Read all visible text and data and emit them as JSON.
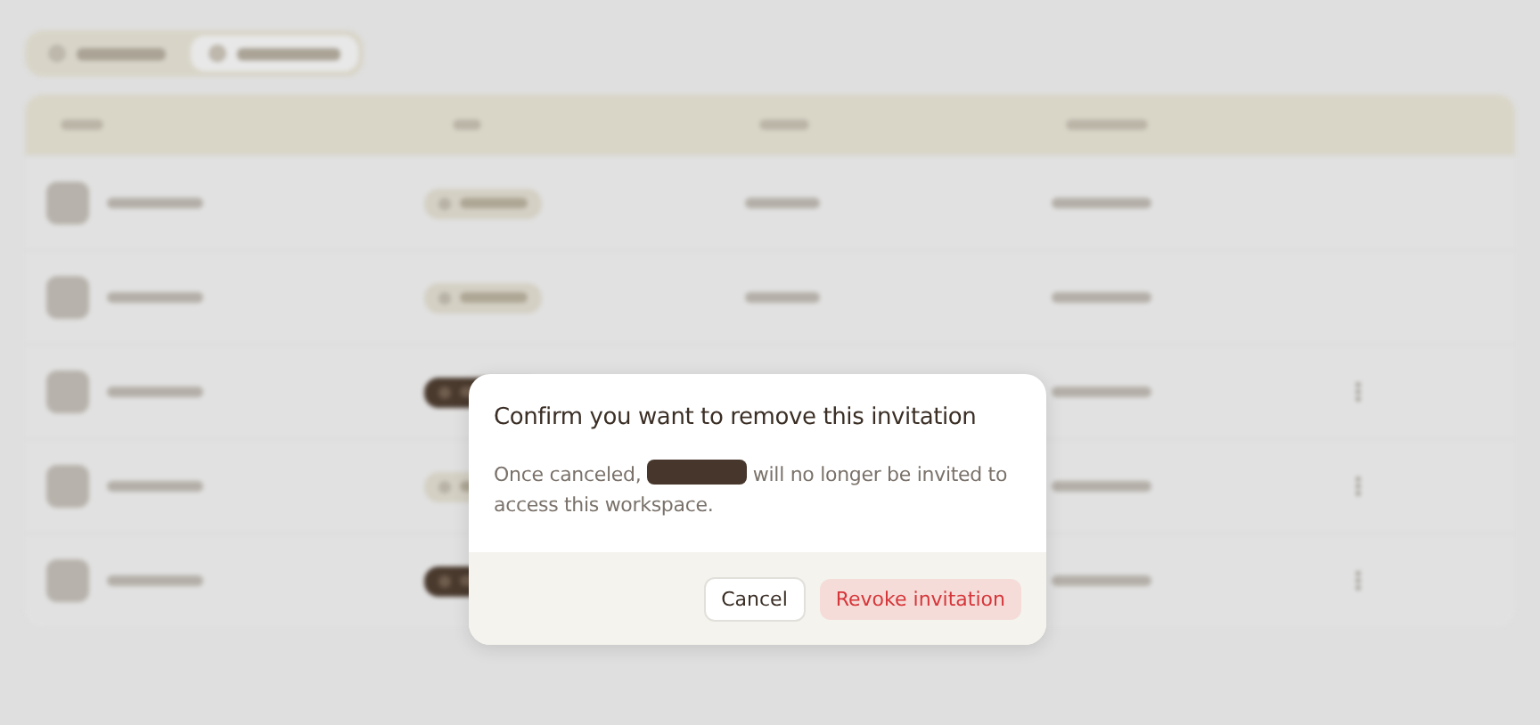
{
  "tabs": [
    {
      "selected": false
    },
    {
      "selected": true
    }
  ],
  "table": {
    "rows": [
      {
        "role_highlighted": false,
        "menu": false
      },
      {
        "role_highlighted": false,
        "menu": false
      },
      {
        "role_highlighted": true,
        "menu": true
      },
      {
        "role_highlighted": false,
        "menu": true
      },
      {
        "role_highlighted": true,
        "menu": true
      }
    ]
  },
  "dialog": {
    "title": "Confirm you want to remove this invitation",
    "message_before": "Once canceled,",
    "message_after": "will no longer be invited to access this workspace.",
    "buttons": [
      {
        "label": "Cancel",
        "kind": "secondary"
      },
      {
        "label": "Revoke invitation",
        "kind": "danger"
      }
    ]
  }
}
